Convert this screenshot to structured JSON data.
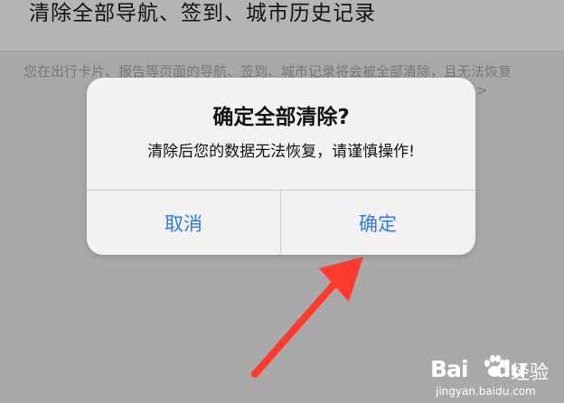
{
  "header": {
    "title": "清除全部导航、签到、城市历史记录"
  },
  "description": {
    "text": "您在出行卡片、报告等页面的导航、签到、城市记录将会被全部清除，且无法恢复",
    "chevron": ">"
  },
  "dialog": {
    "title": "确定全部清除?",
    "message": "清除后您的数据无法恢复，请谨慎操作!",
    "cancel_label": "取消",
    "confirm_label": "确定",
    "accent_color": "#2f7ae5"
  },
  "annotation": {
    "arrow_color": "#ff3b2f",
    "icon": "arrow-pointer-icon"
  },
  "watermark": {
    "logo": "Bai",
    "logo_suffix": "du",
    "cn": "经验",
    "url": "jingyan.baidu.com"
  }
}
